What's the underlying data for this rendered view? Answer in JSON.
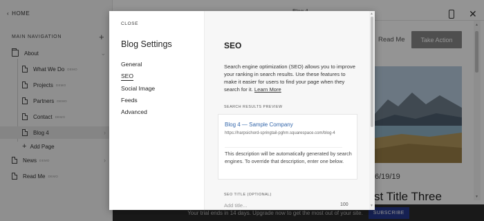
{
  "sidebar": {
    "home_label": "HOME",
    "title": "MAIN NAVIGATION",
    "items": [
      {
        "label": "About",
        "badge": "",
        "icon": "folder-icon"
      },
      {
        "label": "What We Do",
        "badge": "DEMO",
        "icon": "page-icon"
      },
      {
        "label": "Projects",
        "badge": "DEMO",
        "icon": "page-icon"
      },
      {
        "label": "Partners",
        "badge": "DEMO",
        "icon": "page-icon"
      },
      {
        "label": "Contact",
        "badge": "DEMO",
        "icon": "page-icon"
      },
      {
        "label": "Blog 4",
        "badge": "",
        "icon": "page-icon"
      },
      {
        "label": "Add Page",
        "badge": "",
        "icon": "plus-icon"
      },
      {
        "label": "News",
        "badge": "DEMO",
        "icon": "blog-icon"
      },
      {
        "label": "Read Me",
        "badge": "DEMO",
        "icon": "page-icon"
      }
    ]
  },
  "preview": {
    "title": "Blog 4",
    "nav_link": "Read Me",
    "action_button": "Take Action",
    "date": "6/19/19",
    "post_title": "st Title Three"
  },
  "trial": {
    "text": "Your trial ends in 14 days. Upgrade now to get the most out of your site.",
    "button": "SUBSCRIBE"
  },
  "dialog": {
    "close_label": "CLOSE",
    "heading": "Blog Settings",
    "menu": [
      "General",
      "SEO",
      "Social Image",
      "Feeds",
      "Advanced"
    ],
    "active_menu": "SEO",
    "seo": {
      "title": "SEO",
      "description": "Search engine optimization (SEO) allows you to improve your ranking in search results. Use these features to make it easier for users to find your page when they search for it.",
      "learn_more": "Learn More",
      "preview_label": "SEARCH RESULTS PREVIEW",
      "result_title": "Blog 4 — Sample Company",
      "result_url": "https://harpsichord-springtail-pghm.squarespace.com/blog-4",
      "result_desc": "This description will be automatically generated by search engines. To override that description, enter one below.",
      "seo_title_label": "SEO TITLE (OPTIONAL)",
      "seo_title_placeholder": "Add title...",
      "seo_title_count": "100"
    }
  },
  "colors": {
    "accent_link": "#3366aa",
    "subscribe_button": "#273a8f",
    "trial_bar": "#2b2b2b"
  }
}
